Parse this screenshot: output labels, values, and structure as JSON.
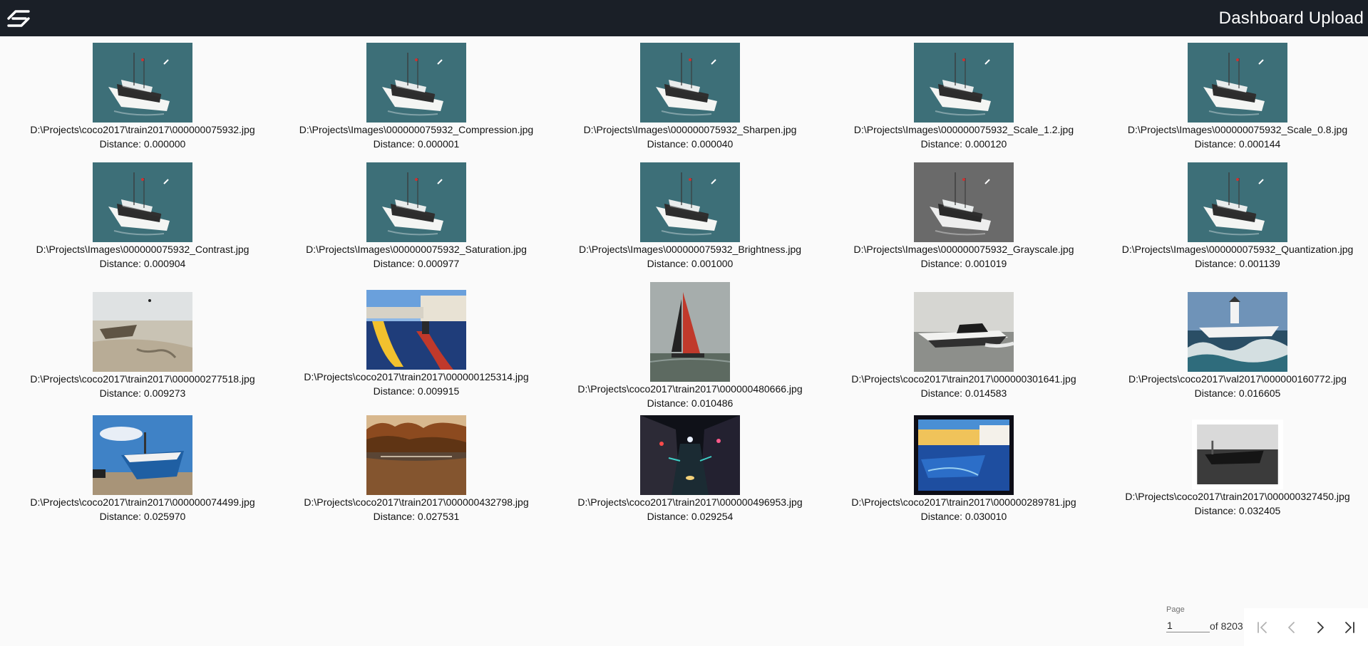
{
  "header": {
    "title": "Dashboard Upload"
  },
  "images": [
    {
      "path": "D:\\Projects\\coco2017\\train2017\\000000075932.jpg",
      "distance": "Distance: 0.000000",
      "thumb": "ferry"
    },
    {
      "path": "D:\\Projects\\Images\\000000075932_Compression.jpg",
      "distance": "Distance: 0.000001",
      "thumb": "ferry"
    },
    {
      "path": "D:\\Projects\\Images\\000000075932_Sharpen.jpg",
      "distance": "Distance: 0.000040",
      "thumb": "ferry"
    },
    {
      "path": "D:\\Projects\\Images\\000000075932_Scale_1.2.jpg",
      "distance": "Distance: 0.000120",
      "thumb": "ferry"
    },
    {
      "path": "D:\\Projects\\Images\\000000075932_Scale_0.8.jpg",
      "distance": "Distance: 0.000144",
      "thumb": "ferry"
    },
    {
      "path": "D:\\Projects\\Images\\000000075932_Contrast.jpg",
      "distance": "Distance: 0.000904",
      "thumb": "ferry"
    },
    {
      "path": "D:\\Projects\\Images\\000000075932_Saturation.jpg",
      "distance": "Distance: 0.000977",
      "thumb": "ferry"
    },
    {
      "path": "D:\\Projects\\Images\\000000075932_Brightness.jpg",
      "distance": "Distance: 0.001000",
      "thumb": "ferry"
    },
    {
      "path": "D:\\Projects\\Images\\000000075932_Grayscale.jpg",
      "distance": "Distance: 0.001019",
      "thumb": "ferry-gray"
    },
    {
      "path": "D:\\Projects\\Images\\000000075932_Quantization.jpg",
      "distance": "Distance: 0.001139",
      "thumb": "ferry"
    },
    {
      "path": "D:\\Projects\\coco2017\\train2017\\000000277518.jpg",
      "distance": "Distance: 0.009273",
      "thumb": "beach-boat"
    },
    {
      "path": "D:\\Projects\\coco2017\\train2017\\000000125314.jpg",
      "distance": "Distance: 0.009915",
      "thumb": "gondolas"
    },
    {
      "path": "D:\\Projects\\coco2017\\train2017\\000000480666.jpg",
      "distance": "Distance: 0.010486",
      "thumb": "sailboat"
    },
    {
      "path": "D:\\Projects\\coco2017\\train2017\\000000301641.jpg",
      "distance": "Distance: 0.014583",
      "thumb": "speedboat"
    },
    {
      "path": "D:\\Projects\\coco2017\\val2017\\000000160772.jpg",
      "distance": "Distance: 0.016605",
      "thumb": "lighthouse"
    },
    {
      "path": "D:\\Projects\\coco2017\\train2017\\000000074499.jpg",
      "distance": "Distance: 0.025970",
      "thumb": "blue-boat"
    },
    {
      "path": "D:\\Projects\\coco2017\\train2017\\000000432798.jpg",
      "distance": "Distance: 0.027531",
      "thumb": "autumn-lake"
    },
    {
      "path": "D:\\Projects\\coco2017\\train2017\\000000496953.jpg",
      "distance": "Distance: 0.029254",
      "thumb": "night-canal"
    },
    {
      "path": "D:\\Projects\\coco2017\\train2017\\000000289781.jpg",
      "distance": "Distance: 0.030010",
      "thumb": "harbor"
    },
    {
      "path": "D:\\Projects\\coco2017\\train2017\\000000327450.jpg",
      "distance": "Distance: 0.032405",
      "thumb": "bw-photo"
    }
  ],
  "pagination": {
    "page_label": "Page",
    "current_page": "1",
    "of_label": "of 8203",
    "first_icon": "first-page-icon",
    "prev_icon": "chevron-left-icon",
    "next_icon": "chevron-right-icon",
    "last_icon": "last-page-icon"
  }
}
